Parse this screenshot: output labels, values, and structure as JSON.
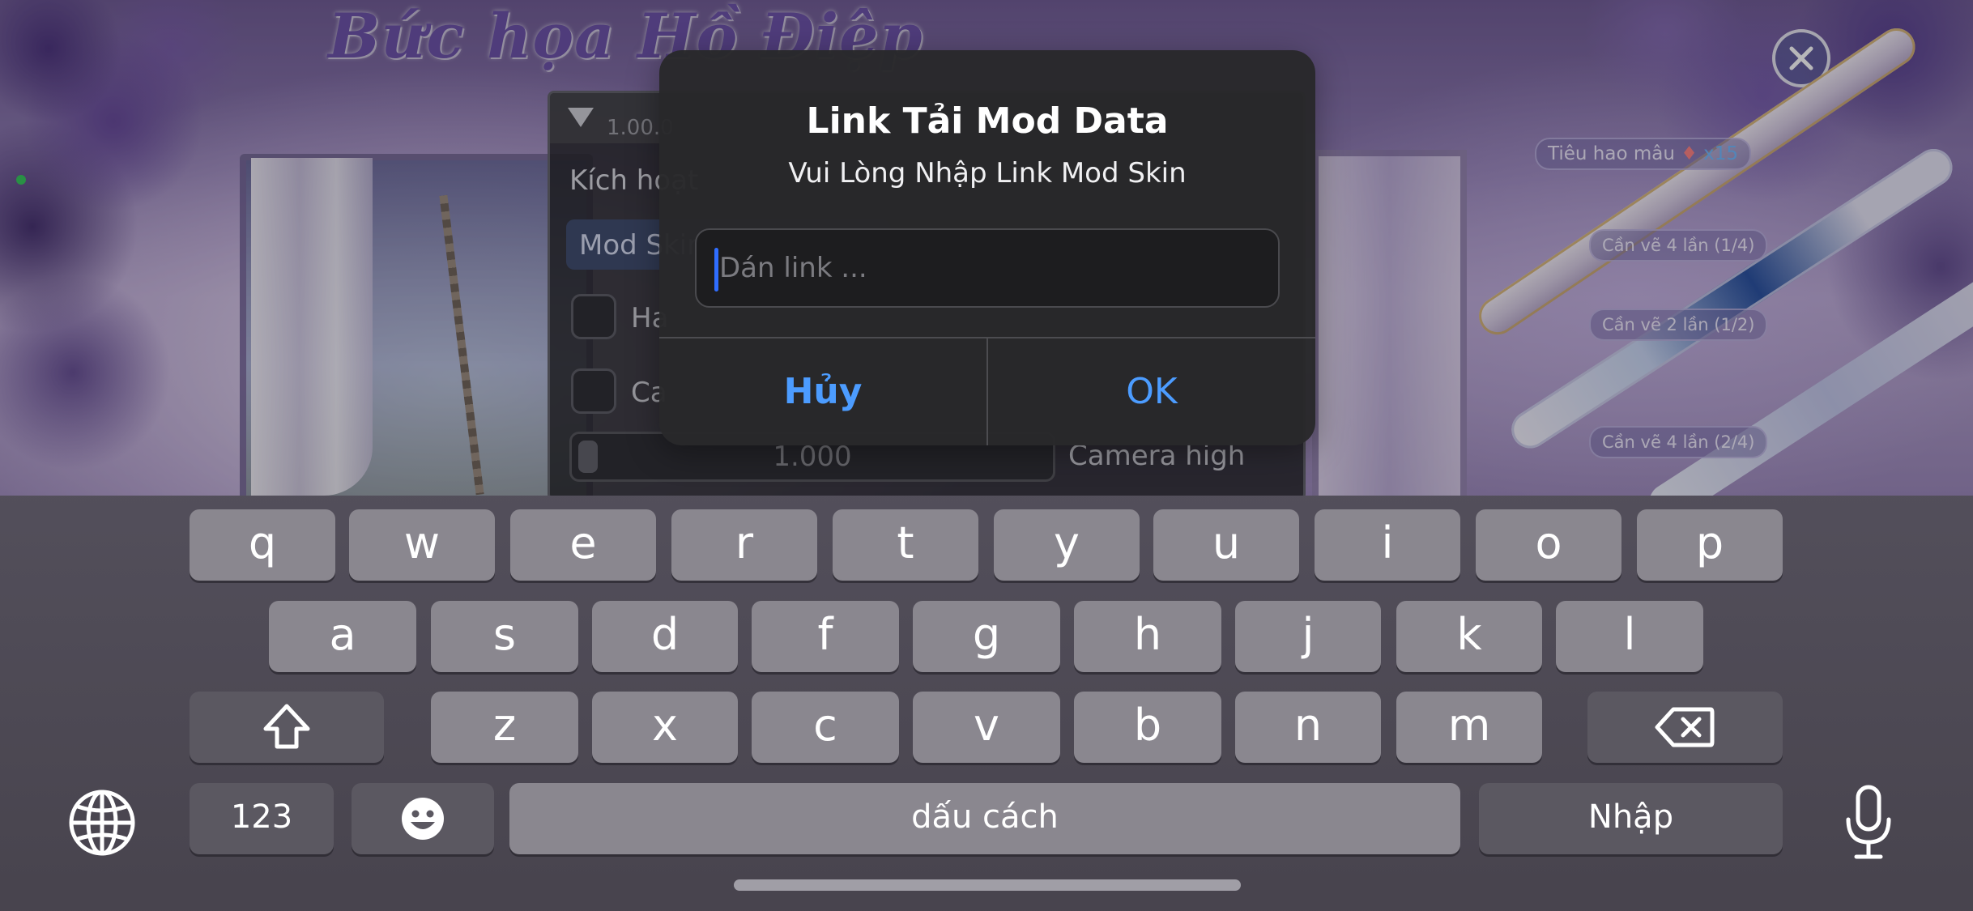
{
  "game": {
    "title": "Bức họa Hồ Điệp",
    "cost_prefix": "Tiêu hao mâu",
    "cost_count": "x15",
    "tags": [
      {
        "label": "Cần vẽ 4 lần (1/4)"
      },
      {
        "label": "Cần vẽ 2 lần (1/2)"
      },
      {
        "label": "Cần vẽ 4 lần (2/4)"
      }
    ]
  },
  "mod_menu": {
    "version": "1.00.0",
    "section_label": "Kích hoạt",
    "select_value": "Mod Skin",
    "checkboxes": [
      {
        "label": "Ha"
      },
      {
        "label": "Ca"
      }
    ],
    "slider": {
      "value_text": "1.000",
      "label": "Camera high"
    }
  },
  "alert": {
    "title": "Link Tải Mod Data",
    "message": "Vui Lòng Nhập Link Mod Skin",
    "input_placeholder": "Dán link ...",
    "input_value": "",
    "cancel_label": "Hủy",
    "ok_label": "OK",
    "accent_color": "#4c9cff"
  },
  "keyboard": {
    "row1": [
      "q",
      "w",
      "e",
      "r",
      "t",
      "y",
      "u",
      "i",
      "o",
      "p"
    ],
    "row2": [
      "a",
      "s",
      "d",
      "f",
      "g",
      "h",
      "j",
      "k",
      "l"
    ],
    "row3": [
      "z",
      "x",
      "c",
      "v",
      "b",
      "n",
      "m"
    ],
    "numbers_label": "123",
    "space_label": "dấu cách",
    "return_label": "Nhập",
    "icons": {
      "shift": "shift-icon",
      "delete": "delete-icon",
      "emoji": "emoji-icon",
      "globe": "globe-icon",
      "mic": "microphone-icon"
    }
  }
}
